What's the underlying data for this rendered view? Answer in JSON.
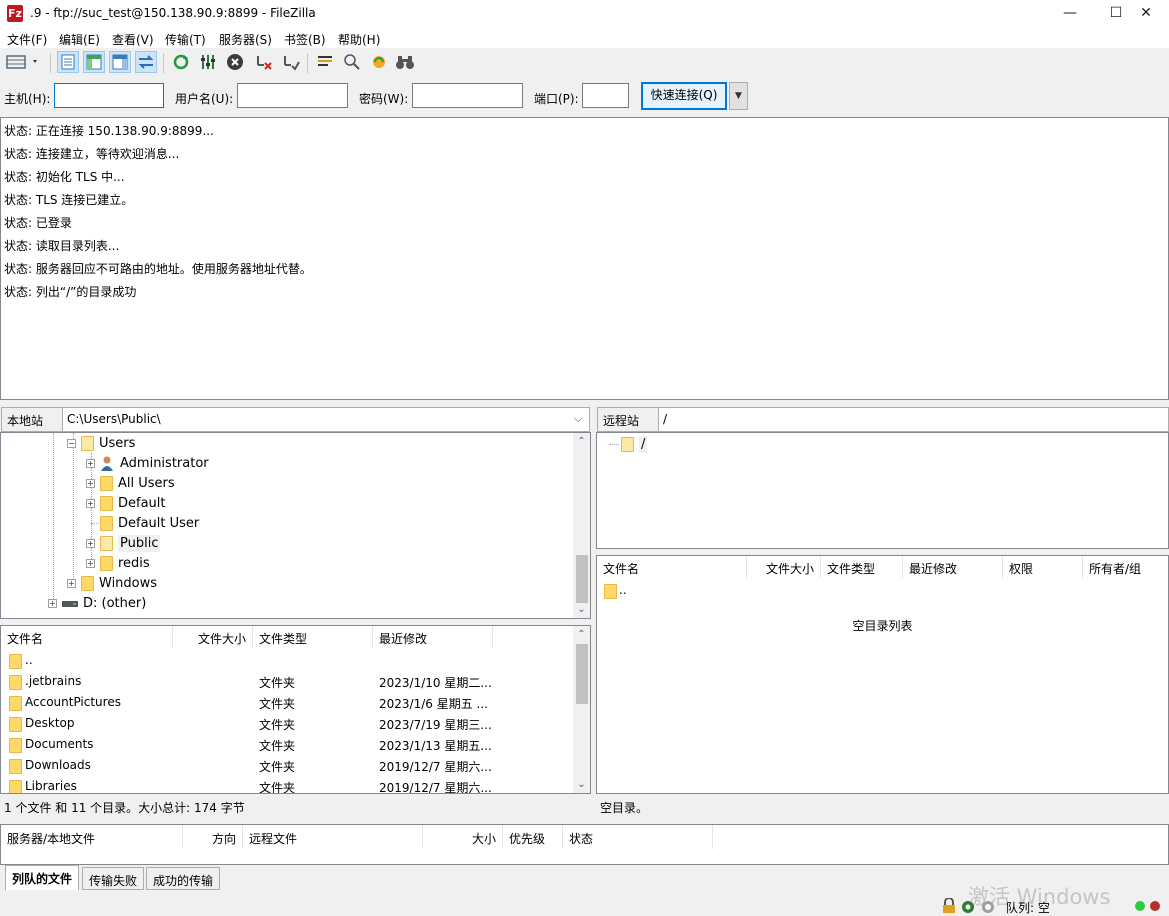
{
  "window": {
    "title": ".9 - ftp://suc_test@150.138.90.9:8899 - FileZilla",
    "app_icon_text": "Fz",
    "minimize": "—",
    "maximize": "☐",
    "close": "✕"
  },
  "menu": [
    "文件(F)",
    "编辑(E)",
    "查看(V)",
    "传输(T)",
    "服务器(S)",
    "书签(B)",
    "帮助(H)"
  ],
  "quickconnect": {
    "host_label": "主机(H):",
    "user_label": "用户名(U):",
    "pass_label": "密码(W):",
    "port_label": "端口(P):",
    "host": "",
    "user": "",
    "pass": "",
    "port": "",
    "connect_button": "快速连接(Q)",
    "dropdown": "▼"
  },
  "log": [
    "状态: 正在连接 150.138.90.9:8899...",
    "状态: 连接建立，等待欢迎消息...",
    "状态: 初始化 TLS 中...",
    "状态: TLS 连接已建立。",
    "状态: 已登录",
    "状态: 读取目录列表...",
    "状态: 服务器回应不可路由的地址。使用服务器地址代替。",
    "状态: 列出“/”的目录成功"
  ],
  "local": {
    "site_label": "本地站点:",
    "site_path": "C:\\Users\\Public\\",
    "tree": {
      "users": "Users",
      "administrator": "Administrator",
      "all_users": "All Users",
      "default": "Default",
      "default_user": "Default User",
      "public": "Public",
      "redis": "redis",
      "windows": "Windows",
      "d_drive": "D: (other)"
    },
    "columns": [
      "文件名",
      "文件大小",
      "文件类型",
      "最近修改"
    ],
    "files": [
      {
        "name": "..",
        "size": "",
        "type": "",
        "modified": ""
      },
      {
        "name": ".jetbrains",
        "size": "",
        "type": "文件夹",
        "modified": "2023/1/10 星期二..."
      },
      {
        "name": "AccountPictures",
        "size": "",
        "type": "文件夹",
        "modified": "2023/1/6 星期五 ..."
      },
      {
        "name": "Desktop",
        "size": "",
        "type": "文件夹",
        "modified": "2023/7/19 星期三..."
      },
      {
        "name": "Documents",
        "size": "",
        "type": "文件夹",
        "modified": "2023/1/13 星期五..."
      },
      {
        "name": "Downloads",
        "size": "",
        "type": "文件夹",
        "modified": "2019/12/7 星期六..."
      },
      {
        "name": "Libraries",
        "size": "",
        "type": "文件夹",
        "modified": "2019/12/7 星期六..."
      }
    ],
    "status": "1 个文件 和 11 个目录。大小总计: 174 字节"
  },
  "remote": {
    "site_label": "远程站点:",
    "site_path": "/",
    "tree_root": "/",
    "columns": [
      "文件名",
      "文件大小",
      "文件类型",
      "最近修改",
      "权限",
      "所有者/组"
    ],
    "files": [
      {
        "name": ".."
      }
    ],
    "empty_message": "空目录列表",
    "status": "空目录。"
  },
  "queue": {
    "columns": [
      "服务器/本地文件",
      "方向",
      "远程文件",
      "大小",
      "优先级",
      "状态"
    ],
    "tabs": [
      "列队的文件",
      "传输失败",
      "成功的传输"
    ]
  },
  "statusbar": {
    "queue_text": "队列: 空",
    "watermark": "激活 Windows"
  },
  "colors": {
    "accent": "#0078d7",
    "folder": "#ffd966",
    "led_green": "#2ecc40",
    "led_red": "#b0322a"
  }
}
